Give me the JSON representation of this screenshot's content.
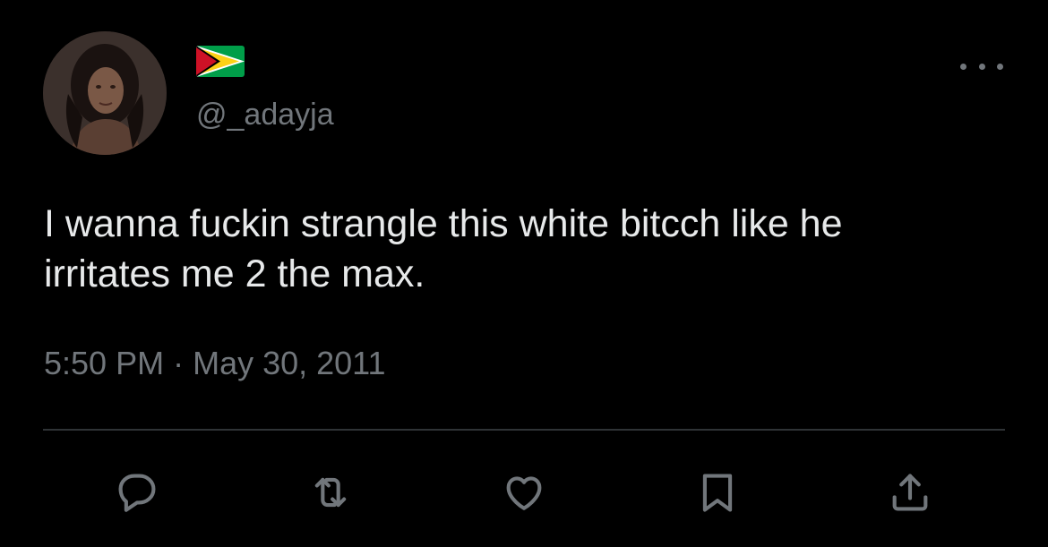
{
  "user": {
    "handle": "@_adayja",
    "flag": "guyana-flag"
  },
  "tweet": {
    "text": "I wanna fuckin strangle this white bitcch like he\nirritates me 2 the max.",
    "time": "5:50 PM",
    "separator": "·",
    "date": "May 30, 2011"
  },
  "icons": {
    "more": "more-horizontal-icon",
    "reply": "reply-icon",
    "retweet": "retweet-icon",
    "like": "heart-icon",
    "bookmark": "bookmark-icon",
    "share": "share-icon"
  },
  "colors": {
    "background": "#000000",
    "text": "#e7e9ea",
    "secondary": "#71767b",
    "divider": "#2f3336"
  }
}
